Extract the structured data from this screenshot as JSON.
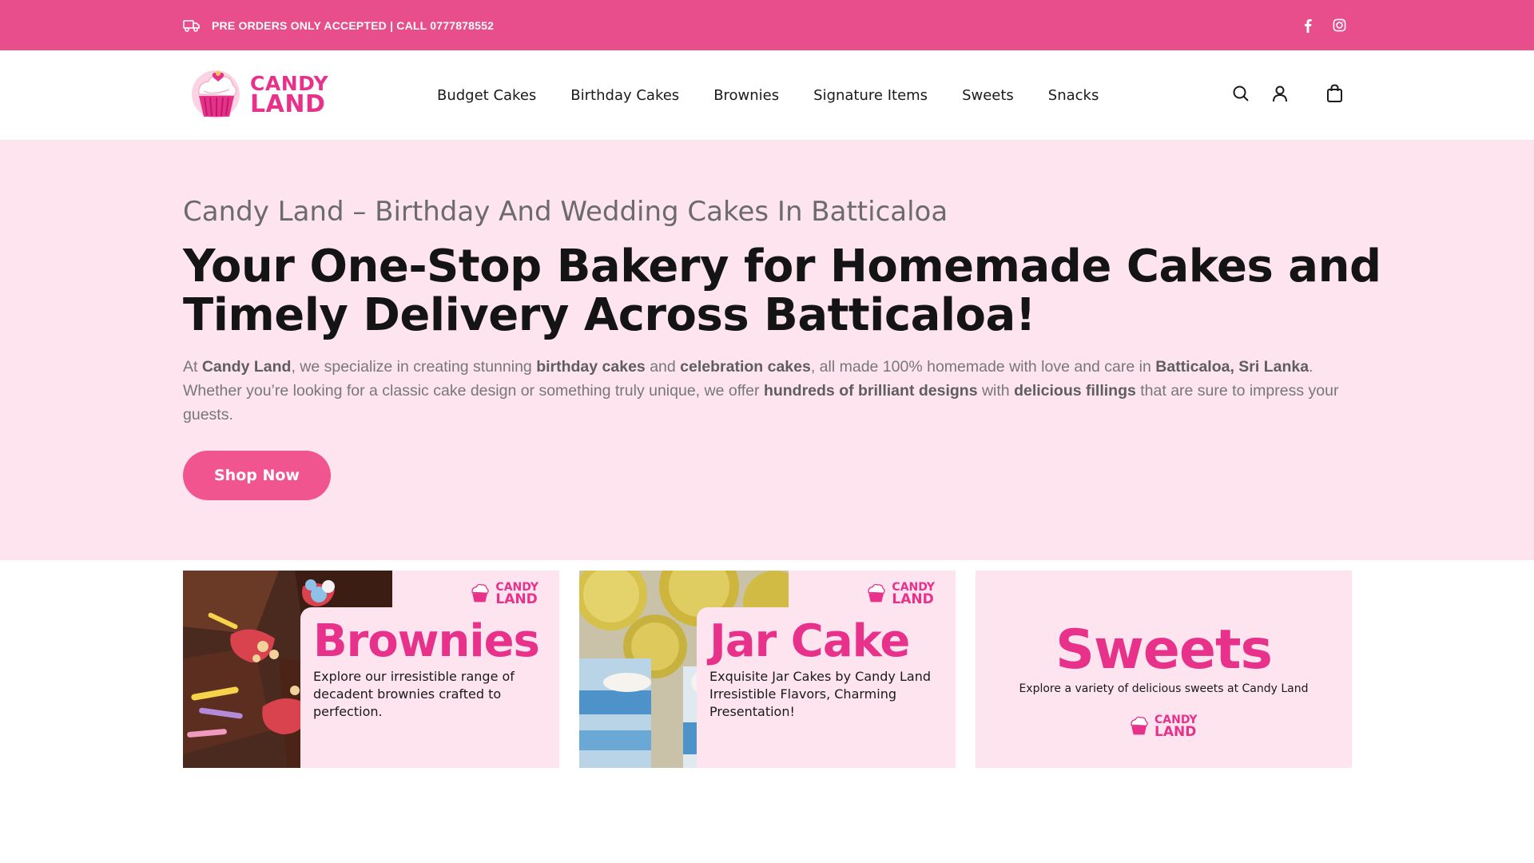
{
  "topbar": {
    "notice": "PRE ORDERS ONLY ACCEPTED | CALL 0777878552",
    "icons": [
      "truck-icon",
      "facebook-icon",
      "instagram-icon"
    ],
    "color": "#e84e8c"
  },
  "header": {
    "logo": {
      "line1": "CANDY",
      "line2": "LAND"
    },
    "nav": [
      "Budget Cakes",
      "Birthday Cakes",
      "Brownies",
      "Signature Items",
      "Sweets",
      "Snacks"
    ],
    "icons": [
      "search-icon",
      "user-icon",
      "shopping-bag-icon"
    ]
  },
  "hero": {
    "eyebrow": "Candy Land – Birthday And Wedding Cakes In Batticaloa",
    "title_line1": "Your One-Stop Bakery for Homemade Cakes and",
    "title_line2": "Timely Delivery Across Batticaloa!",
    "desc": {
      "t1": "At ",
      "b1": "Candy Land",
      "t2": ", we specialize in creating stunning ",
      "b2": "birthday cakes",
      "t3": " and ",
      "b3": "celebration cakes",
      "t4": ", all made 100% homemade with love and care in ",
      "b4": "Batticaloa, Sri Lanka",
      "t5": ". Whether you’re looking for a classic cake design or something truly unique, we offer ",
      "b5": "hundreds of brilliant designs",
      "t6": " with ",
      "b6": "delicious fillings",
      "t7": " that are sure to impress your guests."
    },
    "button": "Shop Now",
    "background": "#fde4ee",
    "button_color": "#f1558f"
  },
  "cards": [
    {
      "title": "Brownies",
      "desc": "Explore our irresistible range of decadent brownies crafted to perfection.",
      "logo_line1": "CANDY",
      "logo_line2": "LAND"
    },
    {
      "title": "Jar Cake",
      "desc": "Exquisite Jar Cakes by Candy Land Irresistible Flavors, Charming Presentation!",
      "logo_line1": "CANDY",
      "logo_line2": "LAND"
    },
    {
      "title": "Sweets",
      "desc": "Explore a variety of delicious sweets at Candy Land",
      "logo_line1": "CANDY",
      "logo_line2": "LAND"
    }
  ],
  "accent": "#e8318a"
}
